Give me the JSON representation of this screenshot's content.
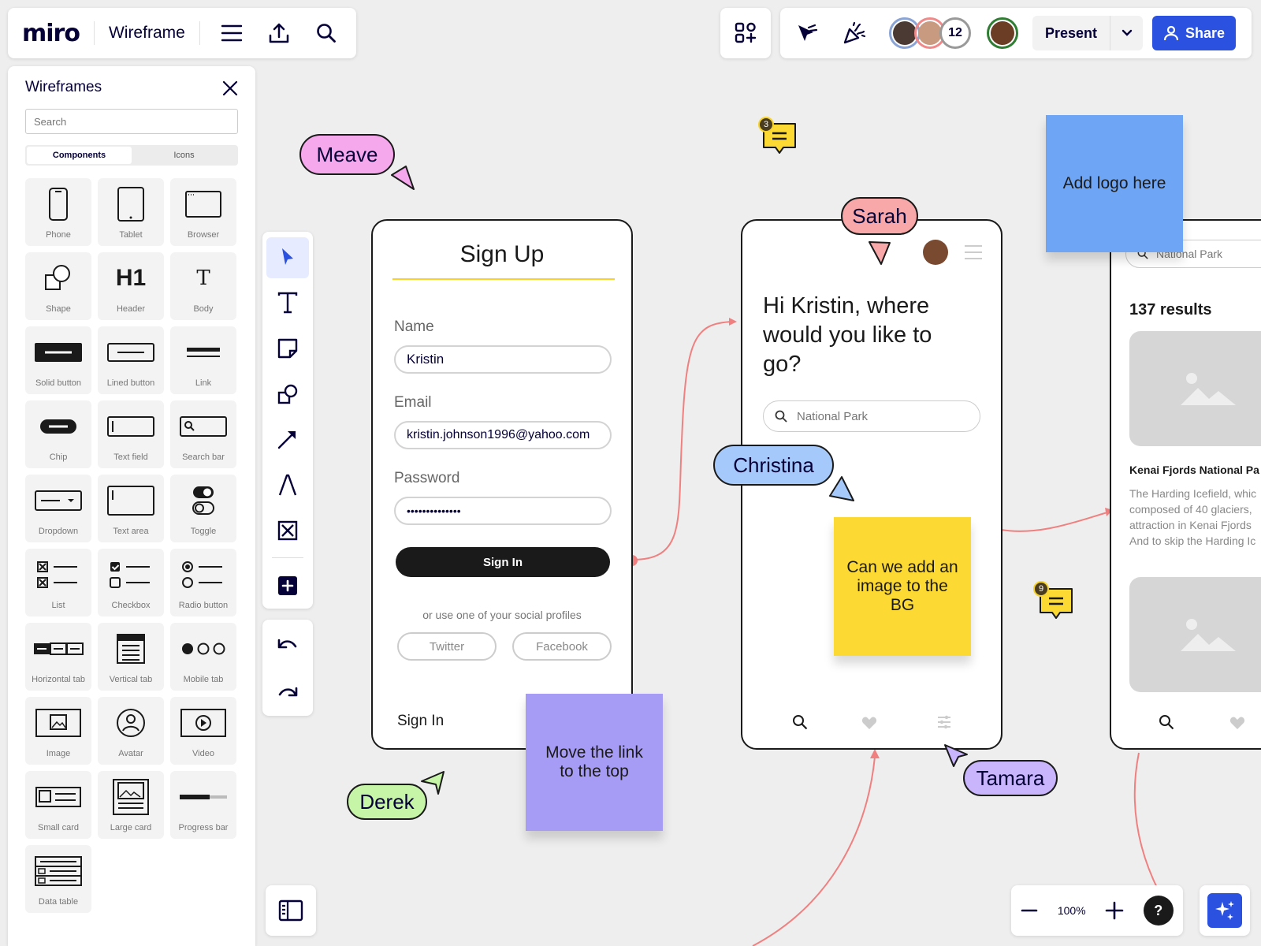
{
  "app": {
    "logo": "miro",
    "board_name": "Wireframe"
  },
  "header": {
    "collaborator_count": "12",
    "present_label": "Present",
    "share_label": "Share"
  },
  "sidebar": {
    "title": "Wireframes",
    "search_placeholder": "Search",
    "tabs": [
      "Components",
      "Icons"
    ],
    "items": [
      {
        "label": "Phone",
        "icon": "phone-icon"
      },
      {
        "label": "Tablet",
        "icon": "tablet-icon"
      },
      {
        "label": "Browser",
        "icon": "browser-icon"
      },
      {
        "label": "Shape",
        "icon": "shape-icon"
      },
      {
        "label": "Header",
        "icon": "header-icon"
      },
      {
        "label": "Body",
        "icon": "body-icon"
      },
      {
        "label": "Solid button",
        "icon": "solid-button-icon"
      },
      {
        "label": "Lined button",
        "icon": "lined-button-icon"
      },
      {
        "label": "Link",
        "icon": "link-icon"
      },
      {
        "label": "Chip",
        "icon": "chip-icon"
      },
      {
        "label": "Text field",
        "icon": "text-field-icon"
      },
      {
        "label": "Search bar",
        "icon": "search-bar-icon"
      },
      {
        "label": "Dropdown",
        "icon": "dropdown-icon"
      },
      {
        "label": "Text area",
        "icon": "text-area-icon"
      },
      {
        "label": "Toggle",
        "icon": "toggle-icon"
      },
      {
        "label": "List",
        "icon": "list-icon"
      },
      {
        "label": "Checkbox",
        "icon": "checkbox-icon"
      },
      {
        "label": "Radio button",
        "icon": "radio-button-icon"
      },
      {
        "label": "Horizontal tab",
        "icon": "horizontal-tab-icon"
      },
      {
        "label": "Vertical tab",
        "icon": "vertical-tab-icon"
      },
      {
        "label": "Mobile tab",
        "icon": "mobile-tab-icon"
      },
      {
        "label": "Image",
        "icon": "image-icon"
      },
      {
        "label": "Avatar",
        "icon": "avatar-icon"
      },
      {
        "label": "Video",
        "icon": "video-icon"
      },
      {
        "label": "Small card",
        "icon": "small-card-icon"
      },
      {
        "label": "Large card",
        "icon": "large-card-icon"
      },
      {
        "label": "Progress bar",
        "icon": "progress-bar-icon"
      },
      {
        "label": "Data table",
        "icon": "data-table-icon"
      }
    ],
    "header_glyph": "H1",
    "body_glyph": "T"
  },
  "zoom": {
    "level": "100%",
    "help": "?"
  },
  "canvas": {
    "signup": {
      "title": "Sign Up",
      "name_label": "Name",
      "name_value": "Kristin",
      "email_label": "Email",
      "email_value": "kristin.johnson1996@yahoo.com",
      "password_label": "Password",
      "password_value": "••••••••••••••",
      "signin_button": "Sign In",
      "social_text": "or use one of your social profiles",
      "twitter": "Twitter",
      "facebook": "Facebook",
      "signin_link": "Sign In"
    },
    "home": {
      "greeting": "Hi Kristin, where would you like to go?",
      "search_value": "National Park"
    },
    "results": {
      "search_value": "National Park",
      "count": "137 results",
      "item_title": "Kenai Fjords National Pa",
      "item_desc": [
        "The Harding Icefield, whic",
        "composed of 40 glaciers,",
        "attraction in Kenai Fjords",
        "And to skip the Harding Ic"
      ]
    },
    "cursors": {
      "meave": "Meave",
      "sarah": "Sarah",
      "christina": "Christina",
      "derek": "Derek",
      "tamara": "Tamara"
    },
    "stickies": {
      "logo": "Add logo here",
      "bg": "Can we add an image to the BG",
      "link": "Move the link to the top"
    },
    "comments": {
      "c1": "3",
      "c2": "9"
    },
    "colors": {
      "accent": "#2a51df",
      "yellow_sticky": "#fcd933",
      "blue_sticky": "#6ea6f5",
      "purple_sticky": "#a79cf5",
      "connector": "#f08080"
    }
  }
}
